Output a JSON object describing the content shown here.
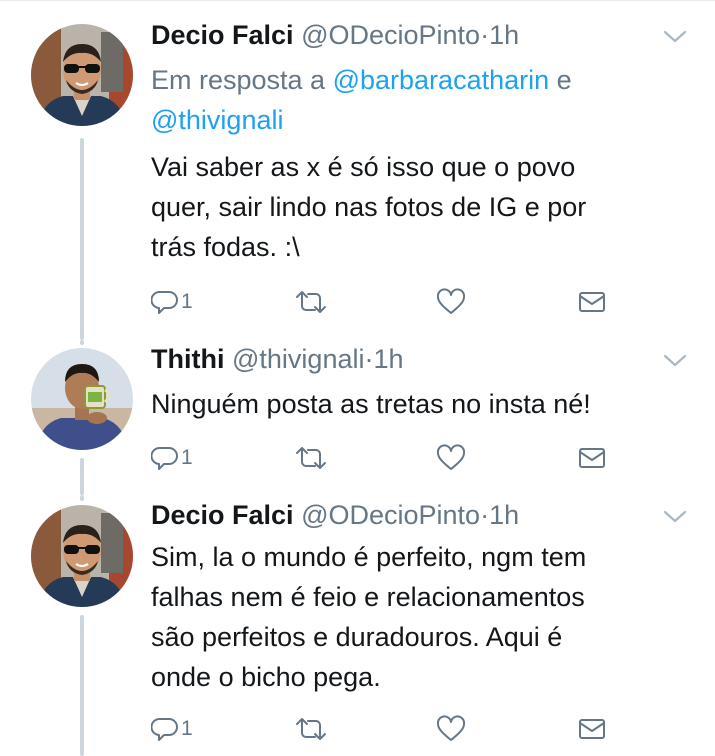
{
  "tweets": [
    {
      "name": "Decio Falci",
      "handle": "@ODecioPinto",
      "separator": "·",
      "time": "1h",
      "reply_prefix": "Em resposta a",
      "reply_user1": "@barbaracatharin",
      "reply_conj": "e",
      "reply_user2": "@thivignali",
      "text_lines": [
        "Vai saber as x é só isso que o povo",
        "quer, sair lindo nas fotos de IG e por",
        "trás fodas. :\\"
      ],
      "reply_count": "1"
    },
    {
      "name": "Thithi",
      "handle": "@thivignali",
      "separator": "·",
      "time": "1h",
      "text_lines": [
        "Ninguém posta as tretas no insta né!"
      ],
      "reply_count": "1"
    },
    {
      "name": "Decio Falci",
      "handle": "@ODecioPinto",
      "separator": "·",
      "time": "1h",
      "text_lines": [
        "Sim, la o mundo é perfeito, ngm tem",
        "falhas nem é feio e relacionamentos",
        "são perfeitos e duradouros. Aqui é",
        "onde o bicho pega."
      ],
      "reply_count": "1"
    }
  ],
  "icons": {
    "reply": "reply-icon",
    "retweet": "retweet-icon",
    "like": "heart-icon",
    "dm": "envelope-icon",
    "more": "chevron-down-icon"
  },
  "colors": {
    "text": "#14171a",
    "secondary": "#657786",
    "link": "#1da1f2",
    "thread_line": "#ccd6dd",
    "divider": "#e6ecf0"
  }
}
